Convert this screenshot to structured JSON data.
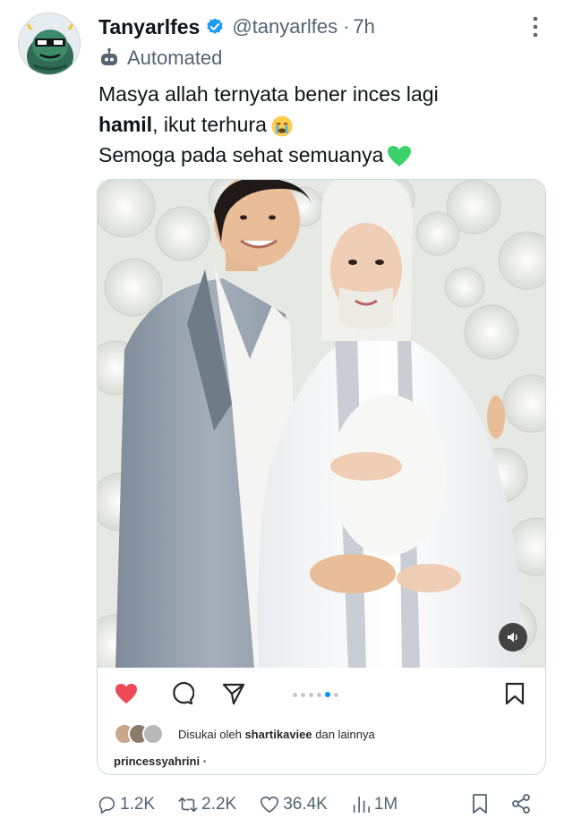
{
  "tweet": {
    "display_name": "Tanyarlfes",
    "handle": "@tanyarlfes",
    "separator": "·",
    "time": "7h",
    "automated_label": "Automated",
    "text_line1": "Masya allah ternyata bener inces lagi",
    "text_bold": "hamil",
    "text_line2_rest": ", ikut terhura",
    "text_line3": "Semoga pada sehat semuanya",
    "emoji_1": "crying-face",
    "emoji_2": "green-heart"
  },
  "instagram_card": {
    "liked_by_prefix": "Disukai oleh",
    "liked_by_user": "shartikaviee",
    "liked_by_suffix": "dan lainnya",
    "owner_text": "princessyahrini ·",
    "carousel_dots": 6,
    "carousel_active_index": 4
  },
  "stats": {
    "replies": "1.2K",
    "reposts": "2.2K",
    "likes": "36.4K",
    "views": "1M"
  },
  "colors": {
    "verified": "#1d9bf0",
    "ig_like": "#ed4956",
    "ig_dot_active": "#0095f6",
    "text_secondary": "#536471"
  },
  "icons": [
    "verified-badge-icon",
    "more-icon",
    "bot-icon",
    "heart-filled-icon",
    "comment-icon",
    "share-icon",
    "bookmark-icon",
    "sound-icon",
    "reply-icon",
    "repost-icon",
    "like-icon",
    "views-icon",
    "share-network-icon"
  ]
}
